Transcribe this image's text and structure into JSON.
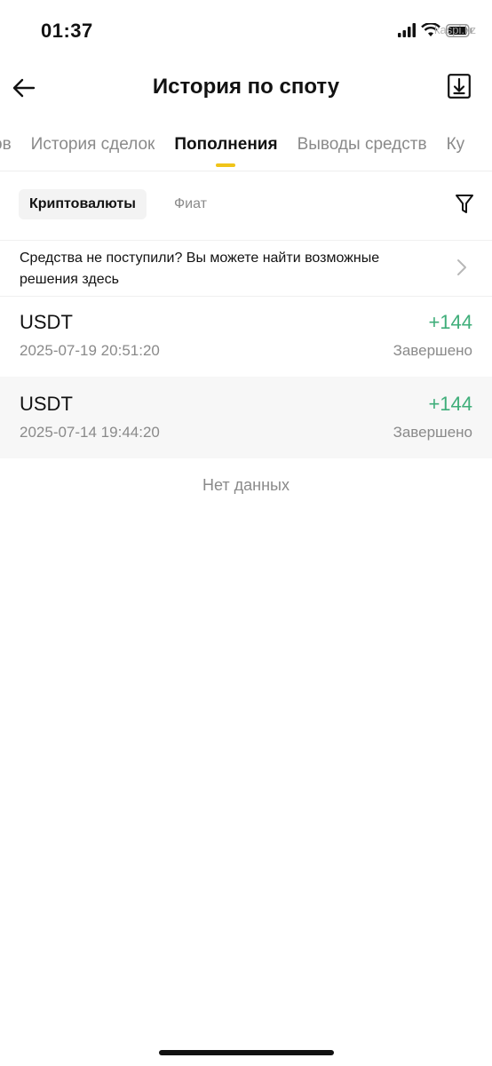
{
  "status_bar": {
    "time": "01:37",
    "watermark": "kaspi.kz",
    "icons": [
      "signal-icon",
      "wifi-icon",
      "battery-icon"
    ]
  },
  "header": {
    "title": "История по споту",
    "back_icon": "arrow-left-icon",
    "download_icon": "download-icon"
  },
  "tabs": {
    "items": [
      {
        "label": "ов"
      },
      {
        "label": "История сделок"
      },
      {
        "label": "Пополнения"
      },
      {
        "label": "Выводы средств"
      },
      {
        "label": "Ку"
      }
    ],
    "active_index": 2,
    "indicator_color": "#f0c419"
  },
  "filters": {
    "crypto_label": "Криптовалюты",
    "fiat_label": "Фиат",
    "filter_icon": "funnel-icon"
  },
  "notice": {
    "text": "Средства не поступили? Вы можете найти возможные решения здесь",
    "chevron_icon": "chevron-right-icon"
  },
  "records": [
    {
      "asset": "USDT",
      "date": "2025-07-19 20:51:20",
      "amount": "+144",
      "status": "Завершено"
    },
    {
      "asset": "USDT",
      "date": "2025-07-14 19:44:20",
      "amount": "+144",
      "status": "Завершено"
    }
  ],
  "empty_text": "Нет данных",
  "colors": {
    "accent": "#f0c419",
    "positive": "#3fae7a",
    "muted": "#8a8a8a"
  }
}
